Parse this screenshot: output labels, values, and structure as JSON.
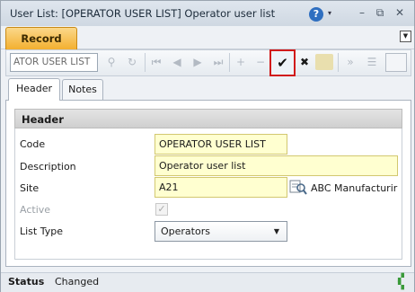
{
  "window": {
    "title": "User List: [OPERATOR USER LIST] Operator user list",
    "help_glyph": "?",
    "help_caret": "▾",
    "minimize_glyph": "–",
    "restore_glyph": "⧉",
    "close_glyph": "✕"
  },
  "record_tab": {
    "label": "Record",
    "menu_glyph": "▼"
  },
  "toolbar": {
    "search_value": "ATOR USER LIST",
    "glyphs": {
      "search": "⚲",
      "refresh": "↻",
      "first": "⏮",
      "prev": "◀",
      "next": "▶",
      "last": "⏭",
      "add": "+",
      "remove": "−",
      "save": "✔",
      "cancel": "✖",
      "expand": "»",
      "list": "☰"
    }
  },
  "tabs": [
    {
      "label": "Header"
    },
    {
      "label": "Notes"
    }
  ],
  "section": {
    "title": "Header"
  },
  "form": {
    "code": {
      "label": "Code",
      "value": "OPERATOR USER LIST"
    },
    "description": {
      "label": "Description",
      "value": "Operator user list"
    },
    "site": {
      "label": "Site",
      "value": "A21",
      "lookup_text": "ABC Manufacturir"
    },
    "active": {
      "label": "Active",
      "checked_glyph": "✓"
    },
    "list_type": {
      "label": "List Type",
      "value": "Operators",
      "caret": "▼"
    }
  },
  "status": {
    "label": "Status",
    "value": "Changed"
  },
  "colors": {
    "field_bg": "#ffffd0",
    "tab_orange": "#f3ae2c",
    "highlight": "#d11a1a",
    "help_blue": "#2f6fc0"
  }
}
